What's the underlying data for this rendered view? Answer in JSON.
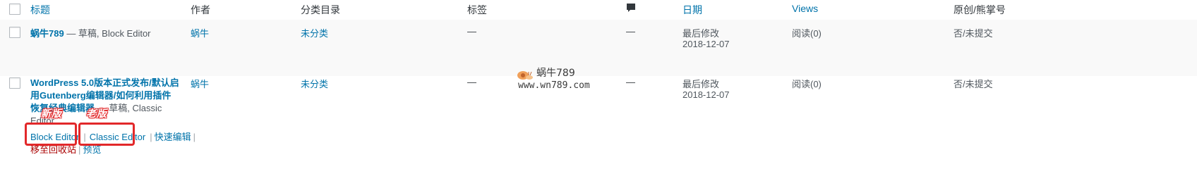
{
  "columns": {
    "title": "标题",
    "author": "作者",
    "categories": "分类目录",
    "tags": "标签",
    "comments_icon": "comment-bubble-icon",
    "date": "日期",
    "views": "Views",
    "original": "原创/熊掌号"
  },
  "posts": [
    {
      "title": "蜗牛789",
      "state": " — 草稿, Block Editor",
      "author": "蜗牛",
      "category": "未分类",
      "tags": "—",
      "comments": "—",
      "date_status": "最后修改",
      "date": "2018-12-07",
      "views": "阅读(0)",
      "original": "否/未提交"
    },
    {
      "title_line1": "WordPress 5.0版本正式发布/默认启",
      "title_line2": "用Gutenberg编辑器/如何利用插件",
      "title_line3": "恢复经典编辑器",
      "state_line3": " — 草稿, Classic",
      "state_line4": "Editor",
      "author": "蜗牛",
      "category": "未分类",
      "tags": "—",
      "comments": "—",
      "date_status": "最后修改",
      "date": "2018-12-07",
      "views": "阅读(0)",
      "original": "否/未提交",
      "actions": {
        "block_editor": "Block Editor",
        "classic_editor": "Classic Editor",
        "quick_edit": "快速编辑",
        "sep": "|",
        "trash": "移至回收站",
        "preview": "预览"
      }
    }
  ],
  "annotations": {
    "new_label": "新版",
    "old_label": "老版"
  },
  "watermark": {
    "name": "蜗牛789",
    "url": "www.wn789.com"
  },
  "colors": {
    "link": "#0073aa",
    "annotation_red": "#e2282a",
    "trash": "#a00"
  }
}
